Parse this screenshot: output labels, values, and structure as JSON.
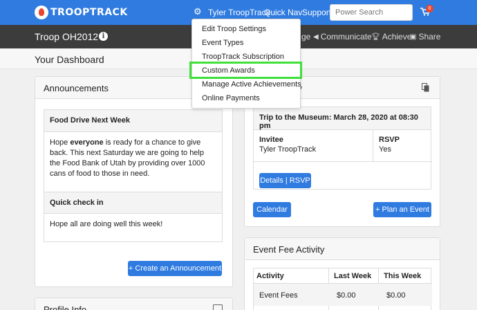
{
  "app": {
    "logo_text": "TROOPTRACK"
  },
  "topnav": {
    "user": "Tyler TroopTrack",
    "quick_nav": "Quick Nav",
    "support": "Support",
    "search_placeholder": "Power Search",
    "cart_count": "0"
  },
  "troopbar": {
    "name": "Troop OH2012",
    "partial_item": "ge",
    "items": [
      "Communicate",
      "Achieve",
      "Share"
    ]
  },
  "dashboard": {
    "title": "Your Dashboard"
  },
  "dropdown": {
    "items": [
      "Edit Troop Settings",
      "Event Types",
      "TroopTrack Subscription",
      "Custom Awards",
      "Manage Active Achievements",
      "Online Payments"
    ]
  },
  "announcements": {
    "header": "Announcements",
    "items": [
      {
        "title": "Food Drive Next Week",
        "body_pre": "Hope ",
        "body_bold": "everyone",
        "body_post": " is ready for a chance to give back. This next Saturday we are going to help the Food Bank of Utah by providing over 1000 cans of food to those in need."
      },
      {
        "title": "Quick check in",
        "body": "Hope all are doing well this week!"
      }
    ],
    "create_button": "+ Create an Announcement"
  },
  "events": {
    "header_partial": "ry",
    "event_title": "Trip to the Museum: March 28, 2020 at 08:30 pm",
    "invitee_label": "Invitee",
    "invitee_value": "Tyler TroopTrack",
    "rsvp_label": "RSVP",
    "rsvp_value": "Yes",
    "details_button": "Details | RSVP",
    "calendar_button": "Calendar",
    "plan_button": "+ Plan an Event"
  },
  "fees": {
    "header": "Event Fee Activity",
    "columns": [
      "Activity",
      "Last Week",
      "This Week"
    ],
    "rows": [
      [
        "Event Fees",
        "$0.00",
        "$0.00"
      ]
    ]
  },
  "profile": {
    "header": "Profile Info"
  }
}
